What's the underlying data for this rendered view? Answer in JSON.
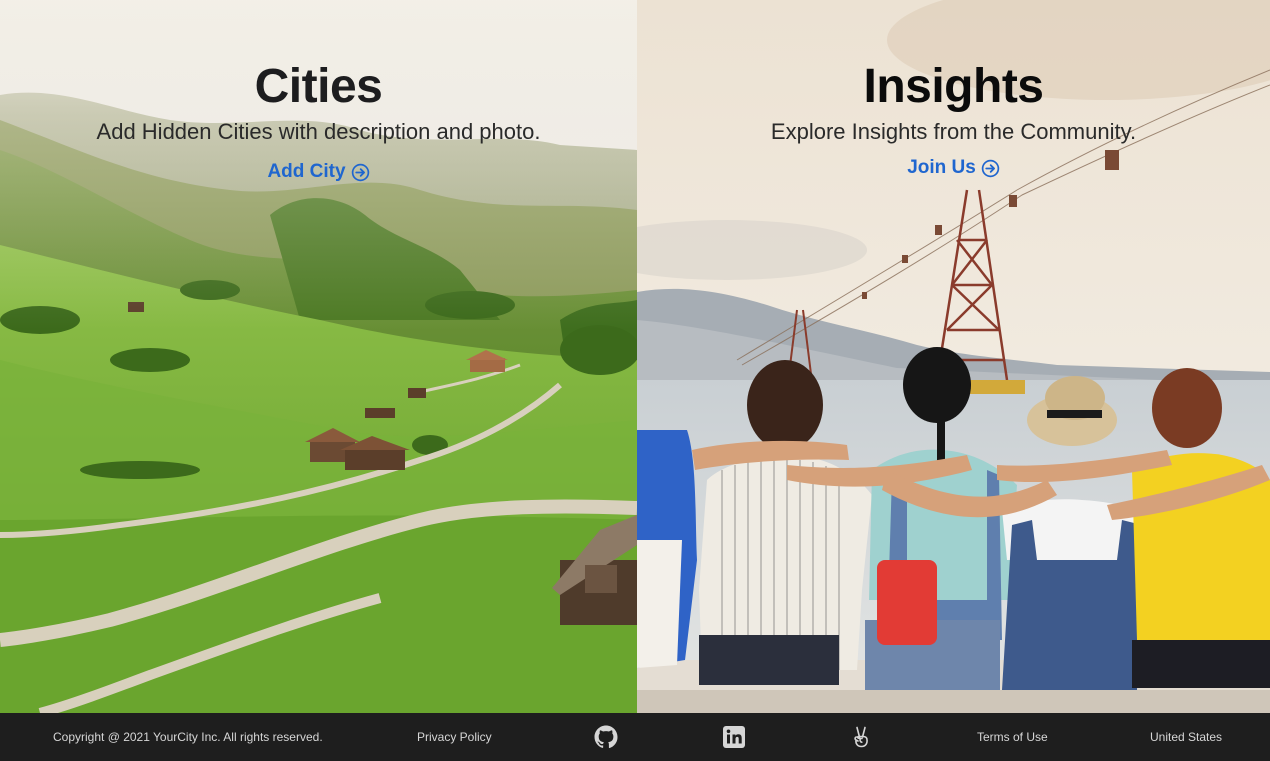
{
  "cities": {
    "title": "Cities",
    "subtitle": "Add Hidden Cities with description and photo.",
    "link_label": "Add City",
    "link_icon": "arrow-circle-right-icon"
  },
  "insights": {
    "title": "Insights",
    "subtitle": "Explore Insights from the Community.",
    "link_label": "Join Us",
    "link_icon": "arrow-circle-right-icon"
  },
  "footer": {
    "copyright": "Copyright @ 2021 YourCity Inc. All rights reserved.",
    "privacy": "Privacy Policy",
    "icons": [
      "github-icon",
      "linkedin-icon",
      "angellist-icon"
    ],
    "terms": "Terms of Use",
    "region": "United States"
  },
  "colors": {
    "link": "#1f66cf",
    "footer_bg": "#1e1e1e",
    "footer_text": "#d6d6d6"
  }
}
